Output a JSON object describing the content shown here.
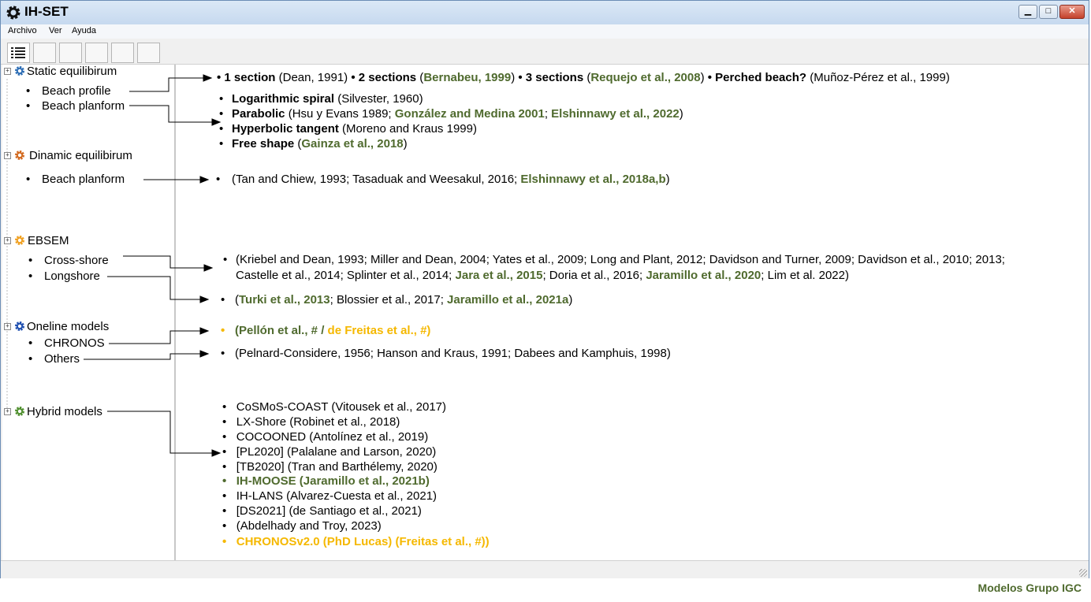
{
  "window": {
    "title": "IH-SET"
  },
  "menu": {
    "file": "Archivo",
    "view": "Ver",
    "help": "Ayuda"
  },
  "tree": {
    "static": {
      "label": "Static equilibirum",
      "children": [
        "Beach profile",
        "Beach planform"
      ],
      "color": "#2e6eb5"
    },
    "dinamic": {
      "label": "Dinamic equilibirum",
      "children": [
        "Beach planform"
      ],
      "color": "#d2691e"
    },
    "ebsem": {
      "label": "EBSEM",
      "children": [
        "Cross-shore",
        "Longshore"
      ],
      "color": "#f0a020"
    },
    "oneline": {
      "label": "Oneline models",
      "children": [
        "CHRONOS",
        "Others"
      ],
      "color": "#1f4fb0"
    },
    "hybrid": {
      "label": "Hybrid models",
      "color": "#4f8f2e"
    }
  },
  "content": {
    "profile": {
      "a1": "1 section",
      "a2": " (Dean, 1991) ",
      "b1": "2 sections",
      "b2": " (",
      "b3": "Bernabeu, 1999",
      "b4": ") ",
      "c1": "3 sections",
      "c2": " (",
      "c3": "Requejo et al., 2008",
      "c4": ") ",
      "d1": "Perched beach?",
      "d2": " (Muñoz-Pérez et al., 1999)"
    },
    "planform": {
      "l1a": "Logarithmic spiral",
      "l1b": " (Silvester, 1960)",
      "l2a": "Parabolic",
      "l2b": " (Hsu y Evans 1989; ",
      "l2c": "González and Medina 2001",
      "l2d": "; ",
      "l2e": "Elshinnawy et al., 2022",
      "l2f": ")",
      "l3a": "Hyperbolic tangent",
      "l3b": " (Moreno and Kraus 1999)",
      "l4a": "Free shape",
      "l4b": " (",
      "l4c": "Gainza et al., 2018",
      "l4d": ")"
    },
    "dinamic": {
      "a": "(Tan and Chiew, 1993; Tasaduak and Weesakul, 2016; ",
      "b": "Elshinnawy et al., 2018a,b",
      "c": ")"
    },
    "cross": {
      "l1": "(Kriebel and Dean, 1993; Miller and Dean, 2004; Yates et al., 2009; Long and Plant, 2012; Davidson and Turner, 2009; Davidson et al., 2010; 2013;",
      "l2a": "Castelle et al., 2014; Splinter et al., 2014; ",
      "l2b": "Jara et al., 2015",
      "l2c": "; Doria et al., 2016; ",
      "l2d": "Jaramillo et al., 2020",
      "l2e": "; Lim et al. 2022)"
    },
    "longshore": {
      "a": "(",
      "b": "Turki et al., 2013",
      "c": "; Blossier et al., 2017; ",
      "d": "Jaramillo et al., 2021a",
      "e": ")"
    },
    "chronos": {
      "a": "(Pellón et al., # / ",
      "b": "de Freitas et al., #)"
    },
    "others": "(Pelnard-Considere, 1956; Hanson and Kraus, 1991; Dabees and Kamphuis, 1998)",
    "hybrid": [
      "CoSMoS-COAST (Vitousek et al., 2017)",
      "LX-Shore (Robinet et al., 2018)",
      "COCOONED (Antolínez et al., 2019)",
      "[PL2020] (Palalane and Larson, 2020)",
      "[TB2020] (Tran and Barthélemy, 2020)",
      "IH-MOOSE (Jaramillo et al., 2021b)",
      "IH-LANS (Alvarez-Cuesta et al., 2021)",
      "[DS2021] (de Santiago et al., 2021)",
      "(Abdelhady and Troy, 2023)",
      "CHRONOSv2.0 (PhD Lucas) (Freitas et al., #))"
    ]
  },
  "footer": "Modelos Grupo IGC"
}
